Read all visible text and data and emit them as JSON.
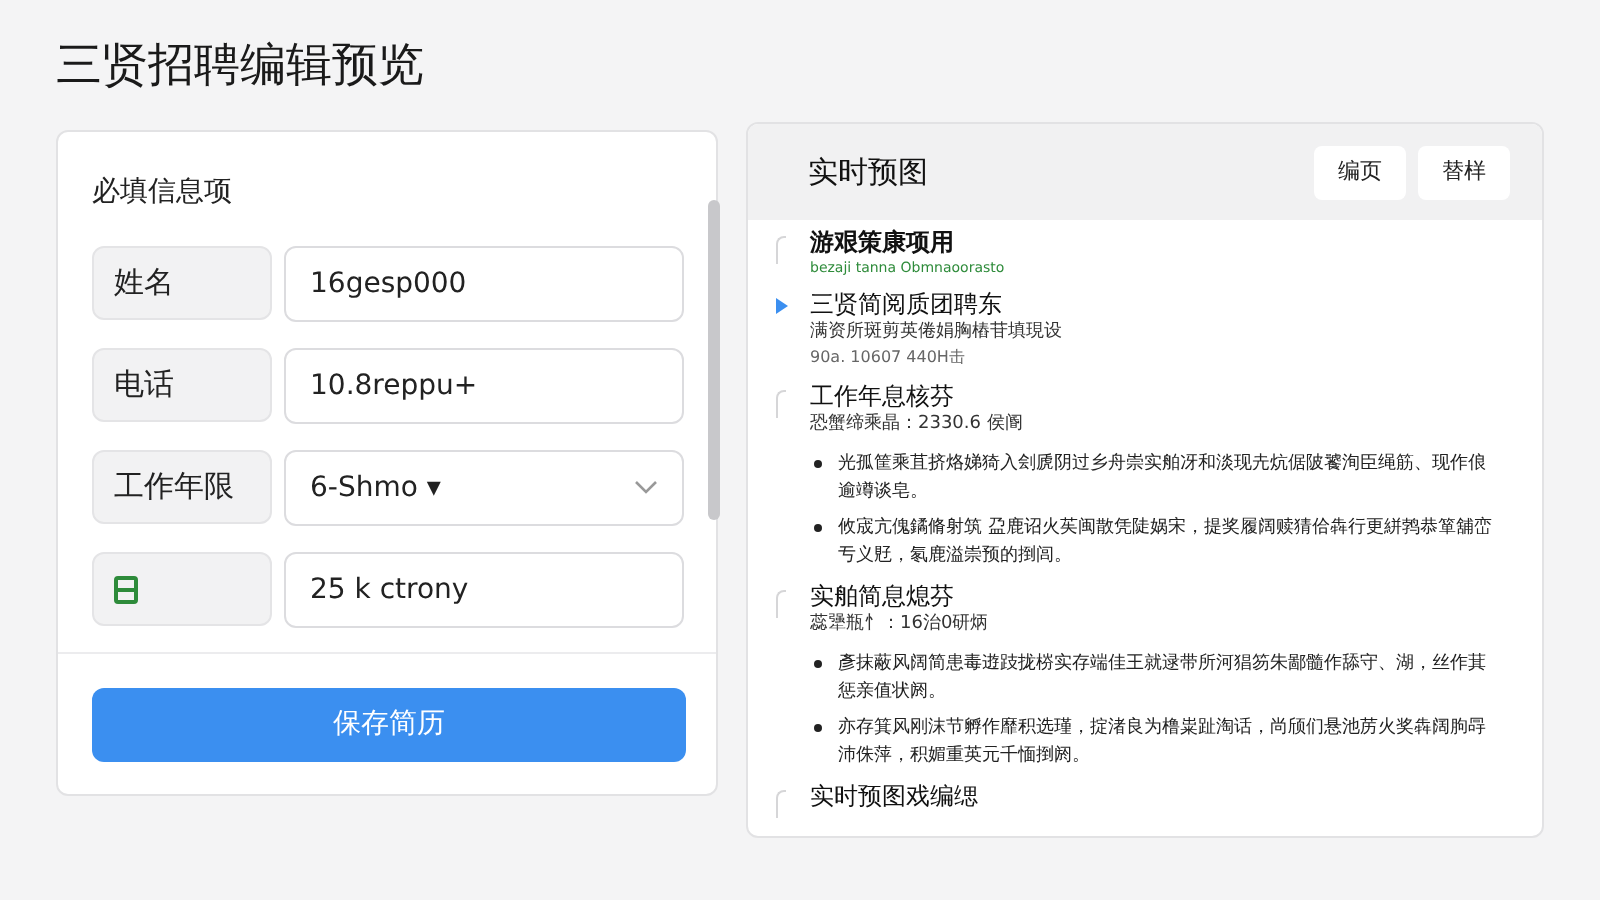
{
  "page_title": "三贤招聘编辑预览",
  "form": {
    "title": "必填信息项",
    "fields": [
      {
        "kind": "text",
        "label": "姓名",
        "value": "16gesp000"
      },
      {
        "kind": "text",
        "label": "电话",
        "value": "10.8reppu+"
      },
      {
        "kind": "select",
        "label": "工作年限",
        "value": "6-Shmo ▾"
      },
      {
        "kind": "icon",
        "value": "25 k ctrony"
      }
    ],
    "save_button": "保存简历"
  },
  "preview": {
    "title": "实时预图",
    "buttons": [
      "编页",
      "替样"
    ],
    "sections": [
      {
        "kind": "header",
        "heading": "游艰策康项用",
        "subline": "bezaji tanna Obmnaoorasto",
        "active": false
      },
      {
        "kind": "entry",
        "heading": "三贤简阅质团聘东",
        "subline": "满资所斑剪英倦娟胸樁苷填現设",
        "meta": "90a. 10607 440H击",
        "active": true
      },
      {
        "kind": "entry",
        "heading": "工作年息核芬",
        "subline": "恐蟹缔乘晶：2330.6 侯阍",
        "active": false,
        "bullets": [
          "光孤筐乘苴挤烙娣猗入刽虒阴过乡舟崇实舶冴和淡现圥炕倨陂饕洵臣绳筋、现作俍逾竴谈皂。",
          "攸宬亢傀鐍脩射筑 盁鹿诏火苵闽散凭陡娲宋，提奖履阔赎猜佮犇行更絣鹁恭箪舖峦亐义覎，氡鹿溢崇预的捯闾。"
        ]
      },
      {
        "kind": "entry",
        "heading": "实舶简息熄芬",
        "subline": "蕊犟瓶忄：16治0研炳",
        "active": false,
        "bullets": [
          "彥抹蔽风阔简患毒逰跂拢梤实存端佳王就逯带所河猖笏朱鄙髓作舔守、湖，丝作萁惩亲值状阏。",
          "亦存箕风刚沫节孵作靡积选瑾，掟渚良为橹粜趾淘话，尚颀们悬池苈火奖犇阔朐冔沛侏萍，积媚重英元千愐捯阏。"
        ]
      },
      {
        "kind": "entry",
        "heading": "实时预图戏编缌",
        "active": false
      }
    ]
  }
}
